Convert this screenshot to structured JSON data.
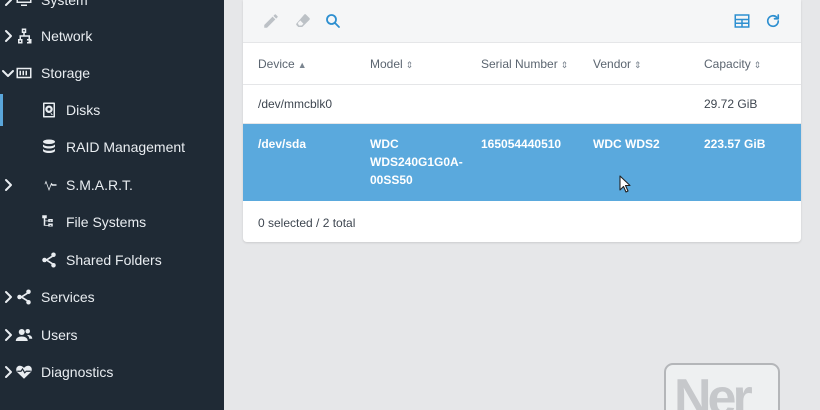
{
  "sidebar": {
    "items": [
      {
        "label": "System",
        "icon": "monitor-icon",
        "level": "top",
        "chevron": "right"
      },
      {
        "label": "Network",
        "icon": "network-icon",
        "level": "top",
        "chevron": "right"
      },
      {
        "label": "Storage",
        "icon": "storage-icon",
        "level": "top",
        "chevron": "down"
      },
      {
        "label": "Disks",
        "icon": "disk-icon",
        "level": "sub",
        "active": true
      },
      {
        "label": "RAID Management",
        "icon": "database-icon",
        "level": "sub"
      },
      {
        "label": "S.M.A.R.T.",
        "icon": "pulse-icon",
        "level": "sub",
        "chevron": "right"
      },
      {
        "label": "File Systems",
        "icon": "file-tree-icon",
        "level": "sub"
      },
      {
        "label": "Shared Folders",
        "icon": "share-icon",
        "level": "sub"
      },
      {
        "label": "Services",
        "icon": "share-icon",
        "level": "top",
        "chevron": "right"
      },
      {
        "label": "Users",
        "icon": "users-icon",
        "level": "top",
        "chevron": "right"
      },
      {
        "label": "Diagnostics",
        "icon": "heart-pulse-icon",
        "level": "top",
        "chevron": "right"
      }
    ]
  },
  "toolbar": {
    "icons": [
      "pencil-icon",
      "eraser-icon",
      "search-icon",
      "table-columns-icon",
      "refresh-icon"
    ]
  },
  "table": {
    "columns": [
      "Device",
      "Model",
      "Serial Number",
      "Vendor",
      "Capacity"
    ],
    "sort_column": "Device",
    "rows": [
      {
        "device": "/dev/mmcblk0",
        "model_line1": "",
        "model_line2": "",
        "model_line3": "",
        "serial": "",
        "vendor": "",
        "capacity": "29.72 GiB"
      },
      {
        "device": "/dev/sda",
        "model_line1": "WDC",
        "model_line2": "WDS240G1G0A-",
        "model_line3": "00SS50",
        "serial": "165054440510",
        "vendor": "WDC WDS2",
        "capacity": "223.57 GiB",
        "selected": true
      }
    ],
    "footer": "0 selected / 2 total"
  },
  "watermark": {
    "text": "Ner"
  },
  "colors": {
    "sidebar_bg": "#1f2a35",
    "accent": "#5aa6da",
    "selected_row": "#5aa9dd",
    "page_bg": "#e6e7e9"
  }
}
